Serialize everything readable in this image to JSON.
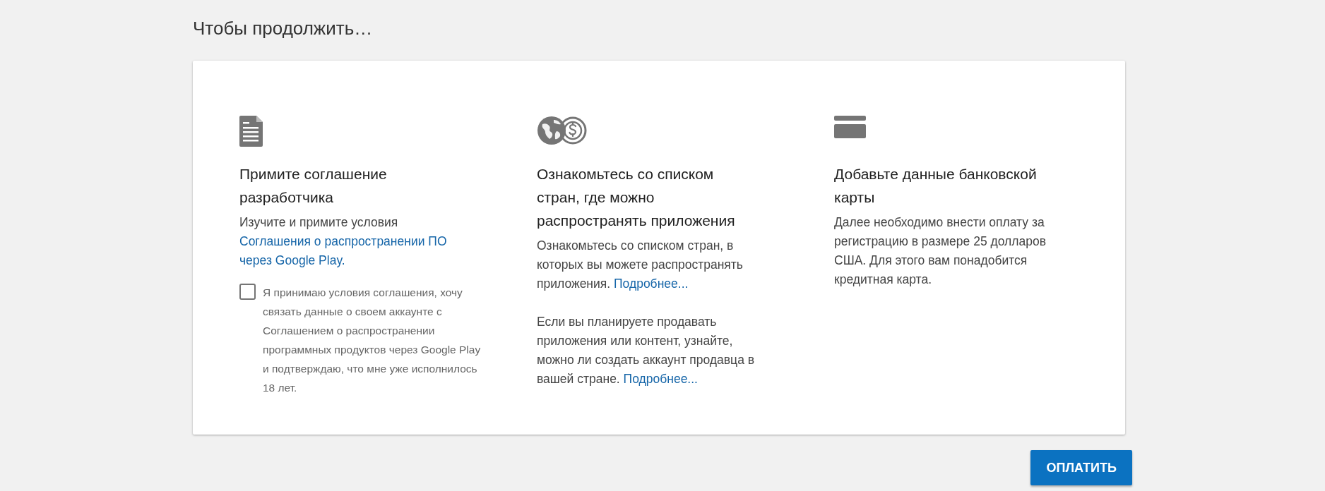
{
  "heading": "Чтобы продолжить…",
  "steps": [
    {
      "kind": "document",
      "title": "Примите соглашение разработчика",
      "paragraphs": [
        [
          {
            "kind": "text",
            "text": "Изучите и примите условия "
          },
          {
            "kind": "block_link",
            "text": "Соглашения о распространении ПО через Google Play."
          }
        ]
      ],
      "checkbox": {
        "checked": false,
        "label": "Я принимаю условия соглашения, хочу связать данные о своем аккаунте с Соглашением о распространении программных продуктов через Google Play и подтверждаю, что мне уже исполнилось 18 лет."
      }
    },
    {
      "kind": "globe-dollar",
      "title": "Ознакомьтесь со списком стран, где можно распространять приложения",
      "paragraphs": [
        [
          {
            "kind": "text",
            "text": "Ознакомьтесь со списком стран, в которых вы можете распространять приложения. "
          },
          {
            "kind": "link",
            "text": "Подробнее..."
          }
        ],
        [
          {
            "kind": "text",
            "text": "Если вы планируете продавать приложения или контент, узнайте, можно ли создать аккаунт продавца в вашей стране. "
          },
          {
            "kind": "link",
            "text": "Подробнее..."
          }
        ]
      ]
    },
    {
      "kind": "card",
      "title": "Добавьте данные банковской карты",
      "paragraphs": [
        [
          {
            "kind": "text",
            "text": "Далее необходимо внести оплату за регистрацию в размере 25 долларов США. Для этого вам понадобится кредитная карта."
          }
        ]
      ]
    }
  ],
  "button": "ОПЛАТИТЬ"
}
